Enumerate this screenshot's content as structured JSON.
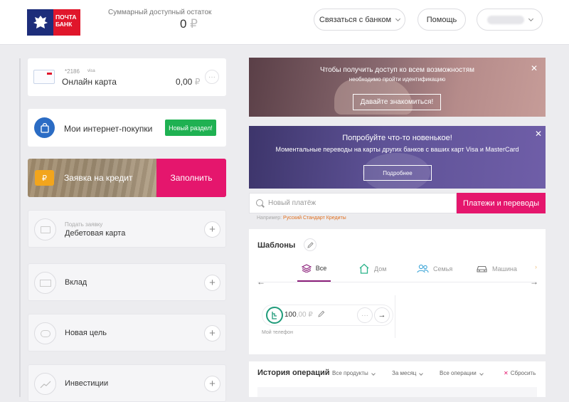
{
  "header": {
    "logo_line1": "ПОЧТА",
    "logo_line2": "БАНК",
    "balance_label": "Суммарный доступный остаток",
    "balance_value": "0",
    "currency": "₽",
    "contact_bank": "Связаться с банком",
    "help": "Помощь"
  },
  "card": {
    "number": "*2186",
    "network": "visa",
    "name": "Онлайн карта",
    "balance": "0,00",
    "currency": "₽"
  },
  "shopping": {
    "label": "Мои интернет-покупки",
    "badge": "Новый раздел!"
  },
  "credit": {
    "label": "Заявка на кредит",
    "button": "Заполнить"
  },
  "products": [
    {
      "sub": "Подать заявку",
      "label": "Дебетовая карта"
    },
    {
      "sub": "",
      "label": "Вклад"
    },
    {
      "sub": "",
      "label": "Новая цель"
    },
    {
      "sub": "",
      "label": "Инвестиции"
    }
  ],
  "banner1": {
    "text": "Чтобы получить доступ ко всем возможностям",
    "sub": "необходимо пройти идентификацию",
    "button": "Давайте знакомиться!"
  },
  "banner2": {
    "title": "Попробуйте что-то новенькое!",
    "text": "Моментальные переводы на карты других банков с ваших карт Visa и MasterCard",
    "button": "Подробнее"
  },
  "search": {
    "placeholder": "Новый платёж",
    "button": "Платежи и переводы",
    "hint_prefix": "Например:",
    "hint_link": "Русский Стандарт Кредиты"
  },
  "templates": {
    "title": "Шаблоны",
    "tabs": [
      "Все",
      "Дом",
      "Семья",
      "Машина"
    ],
    "item": {
      "amount": "100",
      "decimals": ",00",
      "currency": "₽",
      "label": "Мой телефон"
    }
  },
  "history": {
    "title": "История операций",
    "filter_products": "Все продукты",
    "filter_period": "За месяц",
    "filter_ops": "Все операции",
    "reset": "Сбросить"
  },
  "colors": {
    "accent_pink": "#e5166d",
    "brand_blue": "#1d2d7a",
    "brand_red": "#e0162b",
    "green": "#1fb152",
    "tab_active": "#8b1f7a"
  }
}
